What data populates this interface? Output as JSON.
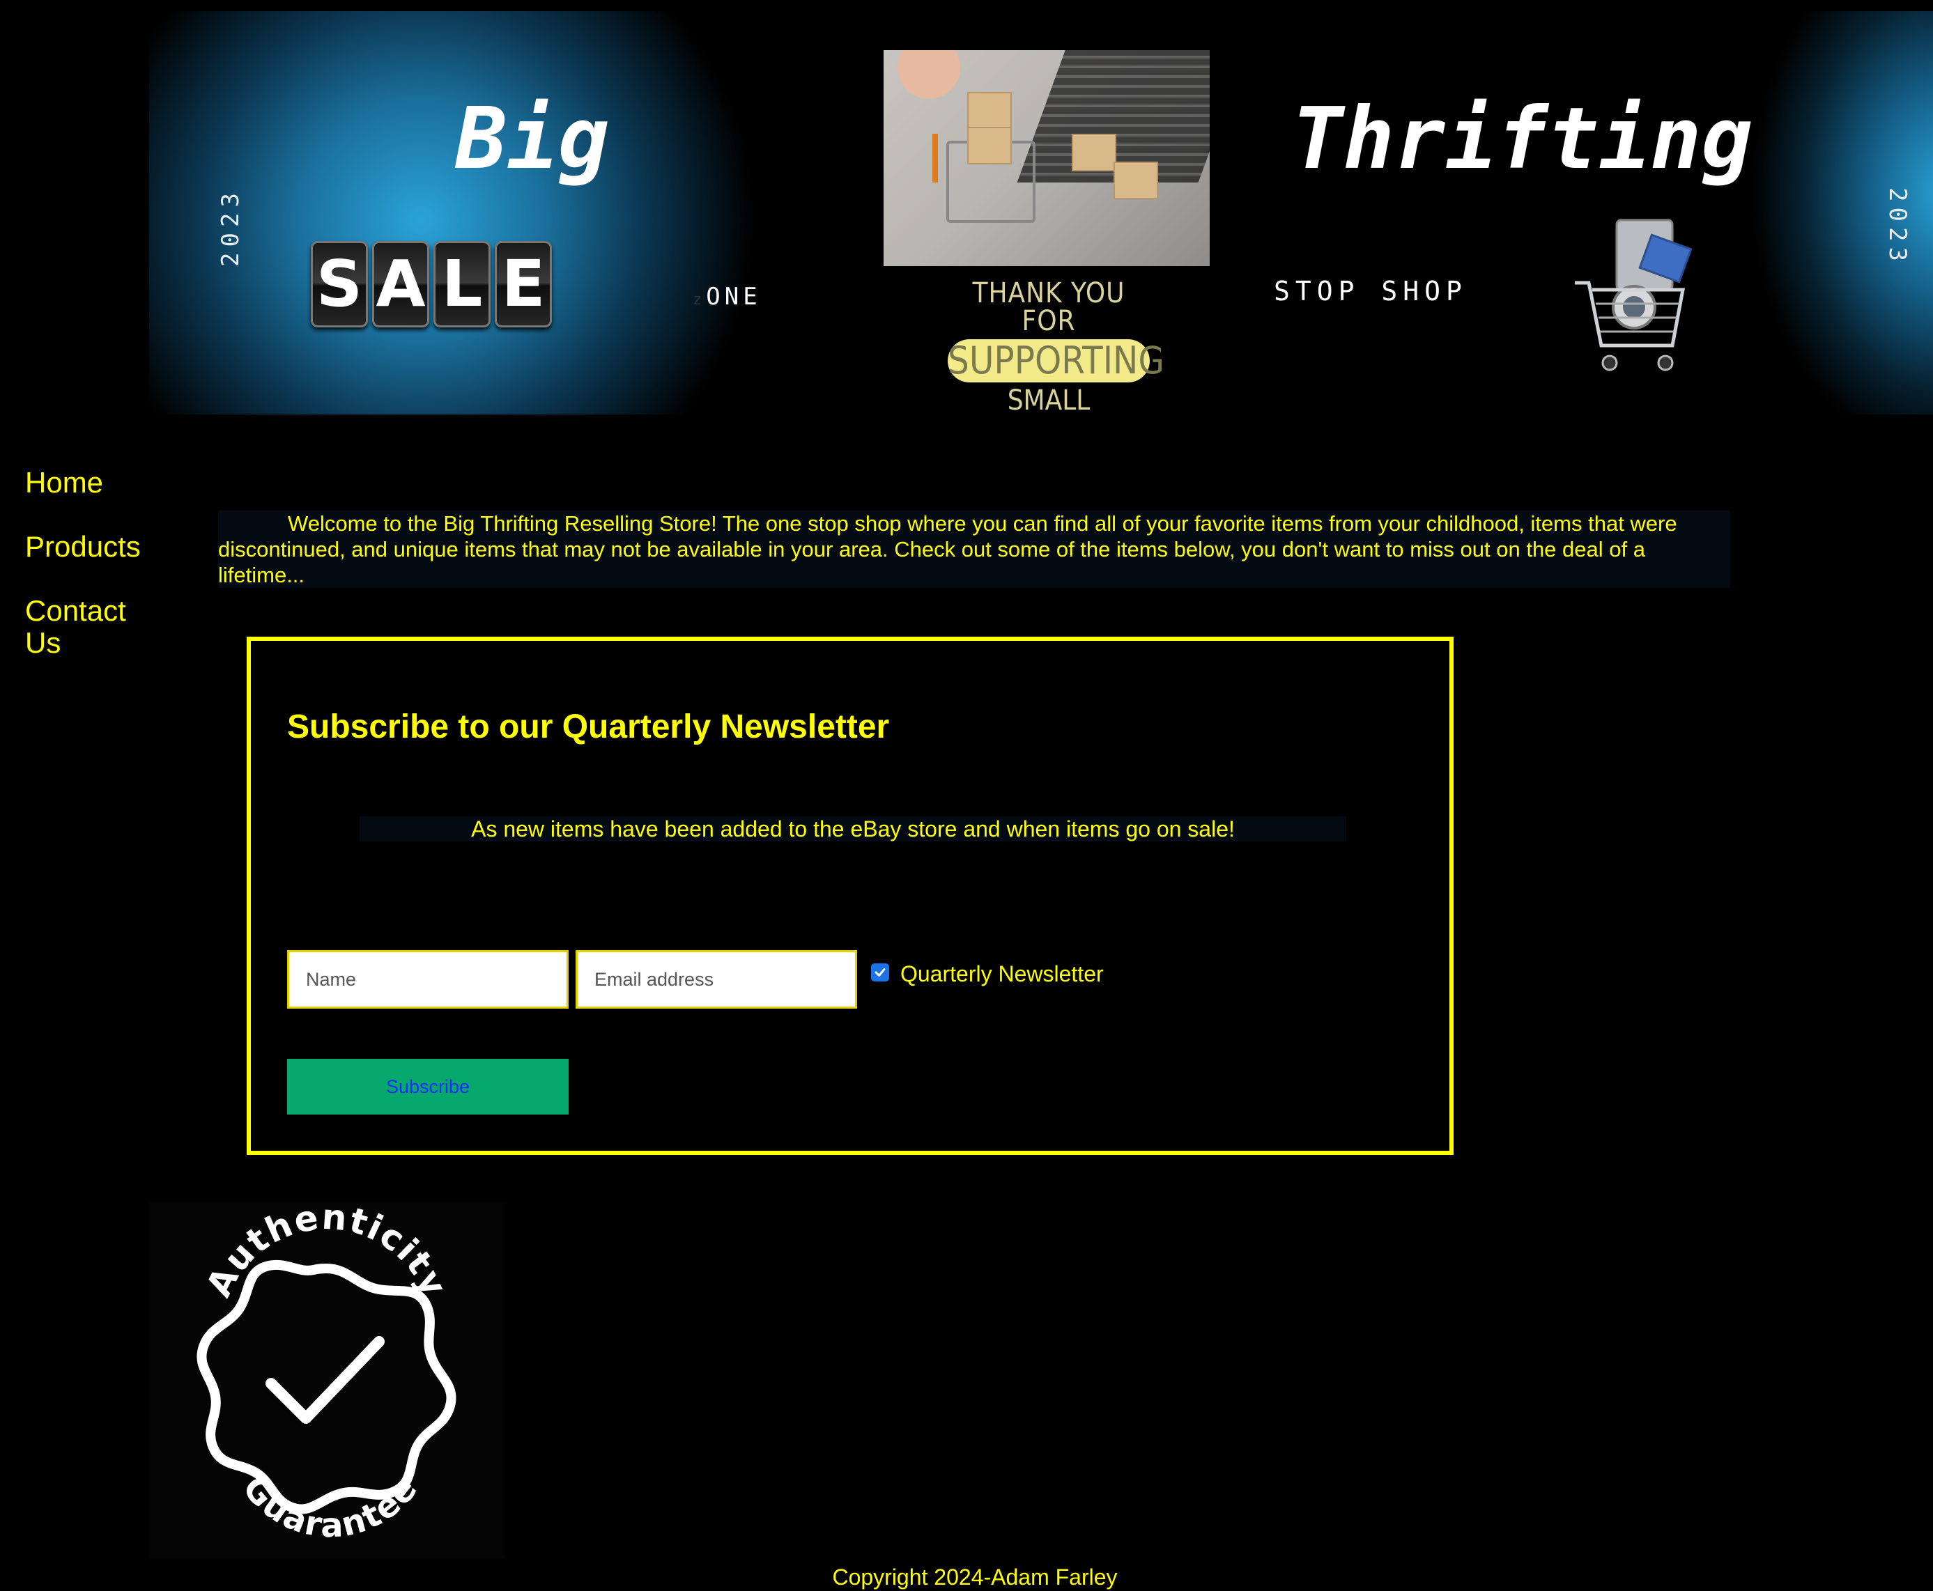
{
  "banner": {
    "year": "2023",
    "big": "Big",
    "sale_letters": [
      "S",
      "A",
      "L",
      "E"
    ],
    "zone_prefix": "z",
    "zone": "ONE",
    "thanks": {
      "line1": "THANK YOU FOR",
      "line2": "SUPPORTING",
      "line3": "SMALL BUSINESS"
    },
    "thrifting": "Thrifting",
    "stop_shop": "STOP SHOP"
  },
  "nav": {
    "items": [
      {
        "label": "Home"
      },
      {
        "label": "Products"
      },
      {
        "label": "Contact Us"
      }
    ]
  },
  "intro": {
    "text": "Welcome to the Big Thrifting Reselling Store! The one stop shop where you can find all of your favorite items from your childhood, items that were discontinued, and unique items that may not be available in your area. Check out some of the items below, you don't want to miss out on the deal of a lifetime..."
  },
  "newsletter": {
    "title": "Subscribe to our Quarterly Newsletter",
    "subtitle": "As new items have been added to the eBay store and when items go on sale!",
    "name_placeholder": "Name",
    "email_placeholder": "Email address",
    "checkbox_label": "Quarterly Newsletter",
    "checkbox_checked": true,
    "subscribe_label": "Subscribe"
  },
  "badge": {
    "top_text": "Authenticity",
    "bottom_text": "Guarantee"
  },
  "footer": {
    "copyright": "Copyright 2024-Adam Farley"
  },
  "colors": {
    "background": "#000000",
    "text": "#ffff00",
    "border": "#ffff00",
    "button": "#06a96b",
    "button_text": "#1b2cff",
    "checkbox": "#1a73e8"
  }
}
